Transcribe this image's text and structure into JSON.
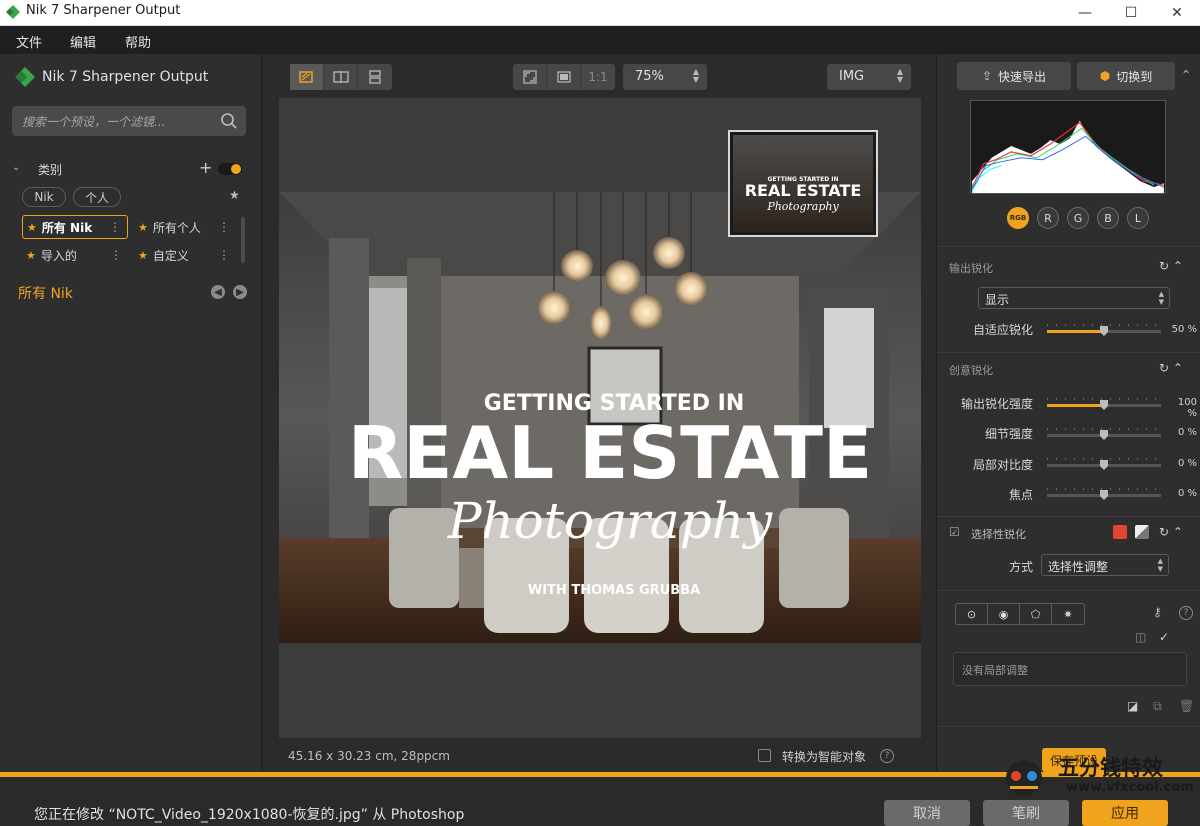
{
  "window": {
    "title": "Nik 7 Sharpener Output",
    "minimize": "—",
    "maximize": "☐",
    "close": "✕"
  },
  "menubar": [
    "文件",
    "编辑",
    "帮助"
  ],
  "left_panel": {
    "title": "Nik 7 Sharpener Output",
    "search_placeholder": "搜索一个预设，一个滤镜...",
    "category_label": "类别",
    "pills": [
      "Nik",
      "个人"
    ],
    "grid": [
      "所有 Nik",
      "所有个人",
      "导入的",
      "自定义"
    ],
    "current": "所有 Nik"
  },
  "center": {
    "zoom": "75%",
    "one_to_one": "1:1",
    "profile": "IMG",
    "status": "45.16 x 30.23 cm, 28ppcm",
    "smart_object_label": "转换为智能对象",
    "image": {
      "line1": "GETTING STARTED IN",
      "line2": "REAL ESTATE",
      "line3": "Photography",
      "line4": "WITH THOMAS GRUBBA"
    }
  },
  "right_panel": {
    "quick_export": "快速导出",
    "switch_to": "切换到",
    "channels": [
      "RGB",
      "R",
      "G",
      "B",
      "L"
    ],
    "output_sharpening": {
      "label": "输出锐化",
      "display_option": "显示",
      "adaptive_label": "自适应锐化",
      "adaptive_value": "50 %",
      "adaptive_level": 0.5
    },
    "creative_sharpening": {
      "label": "创意锐化",
      "sliders": [
        {
          "label": "输出锐化强度",
          "value": "100 %",
          "level": 0.5
        },
        {
          "label": "细节强度",
          "value": "0 %",
          "level": 0.0
        },
        {
          "label": "局部对比度",
          "value": "0 %",
          "level": 0.0
        },
        {
          "label": "焦点",
          "value": "0 %",
          "level": 0.0
        }
      ]
    },
    "selective_sharpening": {
      "label": "选择性锐化",
      "method_label": "方式",
      "method_value": "选择性调整"
    },
    "no_local": "没有局部调整",
    "save_preset": "保存预设"
  },
  "bottom": {
    "message": "您正在修改 “NOTC_Video_1920x1080-恢复的.jpg” 从 Photoshop",
    "cancel": "取消",
    "brush": "笔刷",
    "apply": "应用"
  },
  "watermark": {
    "line1": "五分钱特效",
    "line2": "www.vfxcool.com"
  },
  "colors": {
    "accent": "#f0a31d",
    "panel": "#2e2e2e",
    "menubar": "#1f1f1f"
  }
}
